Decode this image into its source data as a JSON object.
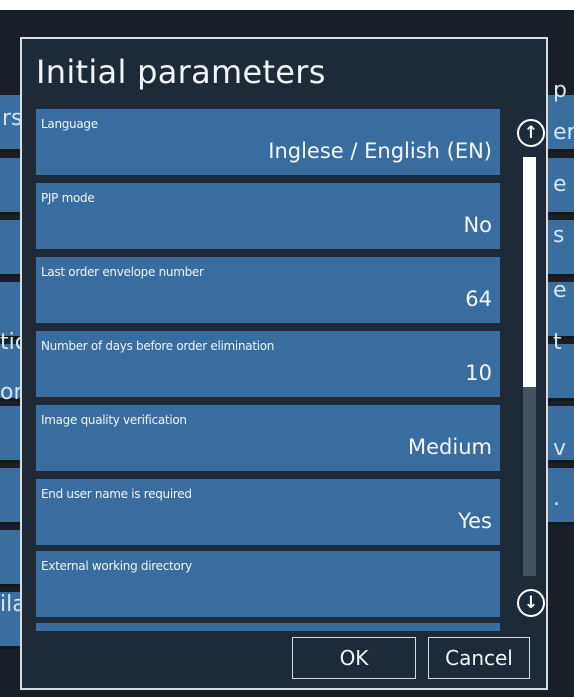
{
  "dialog": {
    "title": "Initial parameters",
    "parameters": [
      {
        "label": "Language",
        "value": "Inglese / English (EN)"
      },
      {
        "label": "PJP mode",
        "value": "No"
      },
      {
        "label": "Last order envelope number",
        "value": "64"
      },
      {
        "label": "Number of days before order elimination",
        "value": "10"
      },
      {
        "label": "Image quality verification",
        "value": "Medium"
      },
      {
        "label": "End user name is required",
        "value": "Yes"
      },
      {
        "label": "External working directory",
        "value": ""
      }
    ],
    "scrollbar": {
      "thumb_fraction": 0.55,
      "scroll_position": 0
    },
    "scroll_up_icon": "arrow-up-circle-icon",
    "scroll_down_icon": "arrow-down-circle-icon",
    "ok_label": "OK",
    "cancel_label": "Cancel"
  },
  "background": {
    "left_fragments": [
      "rs",
      "tic",
      "or",
      "ila"
    ],
    "right_fragments": [
      "p",
      "er",
      "e",
      "s",
      "e",
      "t",
      "v",
      "."
    ]
  },
  "colors": {
    "dialog_bg": "#1e2a37",
    "row_bg": "#3a6d9f",
    "border": "#d9dde2",
    "text": "#f2f5f8"
  }
}
